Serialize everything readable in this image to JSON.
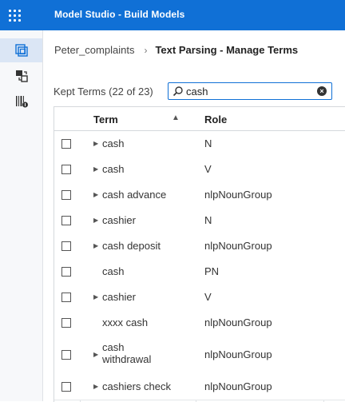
{
  "app": {
    "title": "Model Studio - Build Models"
  },
  "breadcrumb": {
    "project": "Peter_complaints",
    "separator": "›",
    "current": "Text Parsing - Manage Terms"
  },
  "toolbar": {
    "kept_label": "Kept Terms (22 of 23)"
  },
  "search": {
    "value": "cash",
    "placeholder": ""
  },
  "table": {
    "headers": {
      "term": "Term",
      "role": "Role"
    },
    "rows": [
      {
        "term": "cash",
        "role": "N",
        "expandable": true
      },
      {
        "term": "cash",
        "role": "V",
        "expandable": true
      },
      {
        "term": "cash advance",
        "role": "nlpNounGroup",
        "expandable": true
      },
      {
        "term": "cashier",
        "role": "N",
        "expandable": true
      },
      {
        "term": "cash deposit",
        "role": "nlpNounGroup",
        "expandable": true
      },
      {
        "term": "cash",
        "role": "PN",
        "expandable": false
      },
      {
        "term": "cashier",
        "role": "V",
        "expandable": true
      },
      {
        "term": "xxxx cash",
        "role": "nlpNounGroup",
        "expandable": false
      },
      {
        "term": "cash withdrawal",
        "role": "nlpNounGroup",
        "expandable": true
      },
      {
        "term": "cashiers check",
        "role": "nlpNounGroup",
        "expandable": true
      }
    ]
  },
  "colors": {
    "accent": "#1070d6",
    "rail_bg": "#f7f8fa",
    "active_rail": "#dbe6f5"
  }
}
